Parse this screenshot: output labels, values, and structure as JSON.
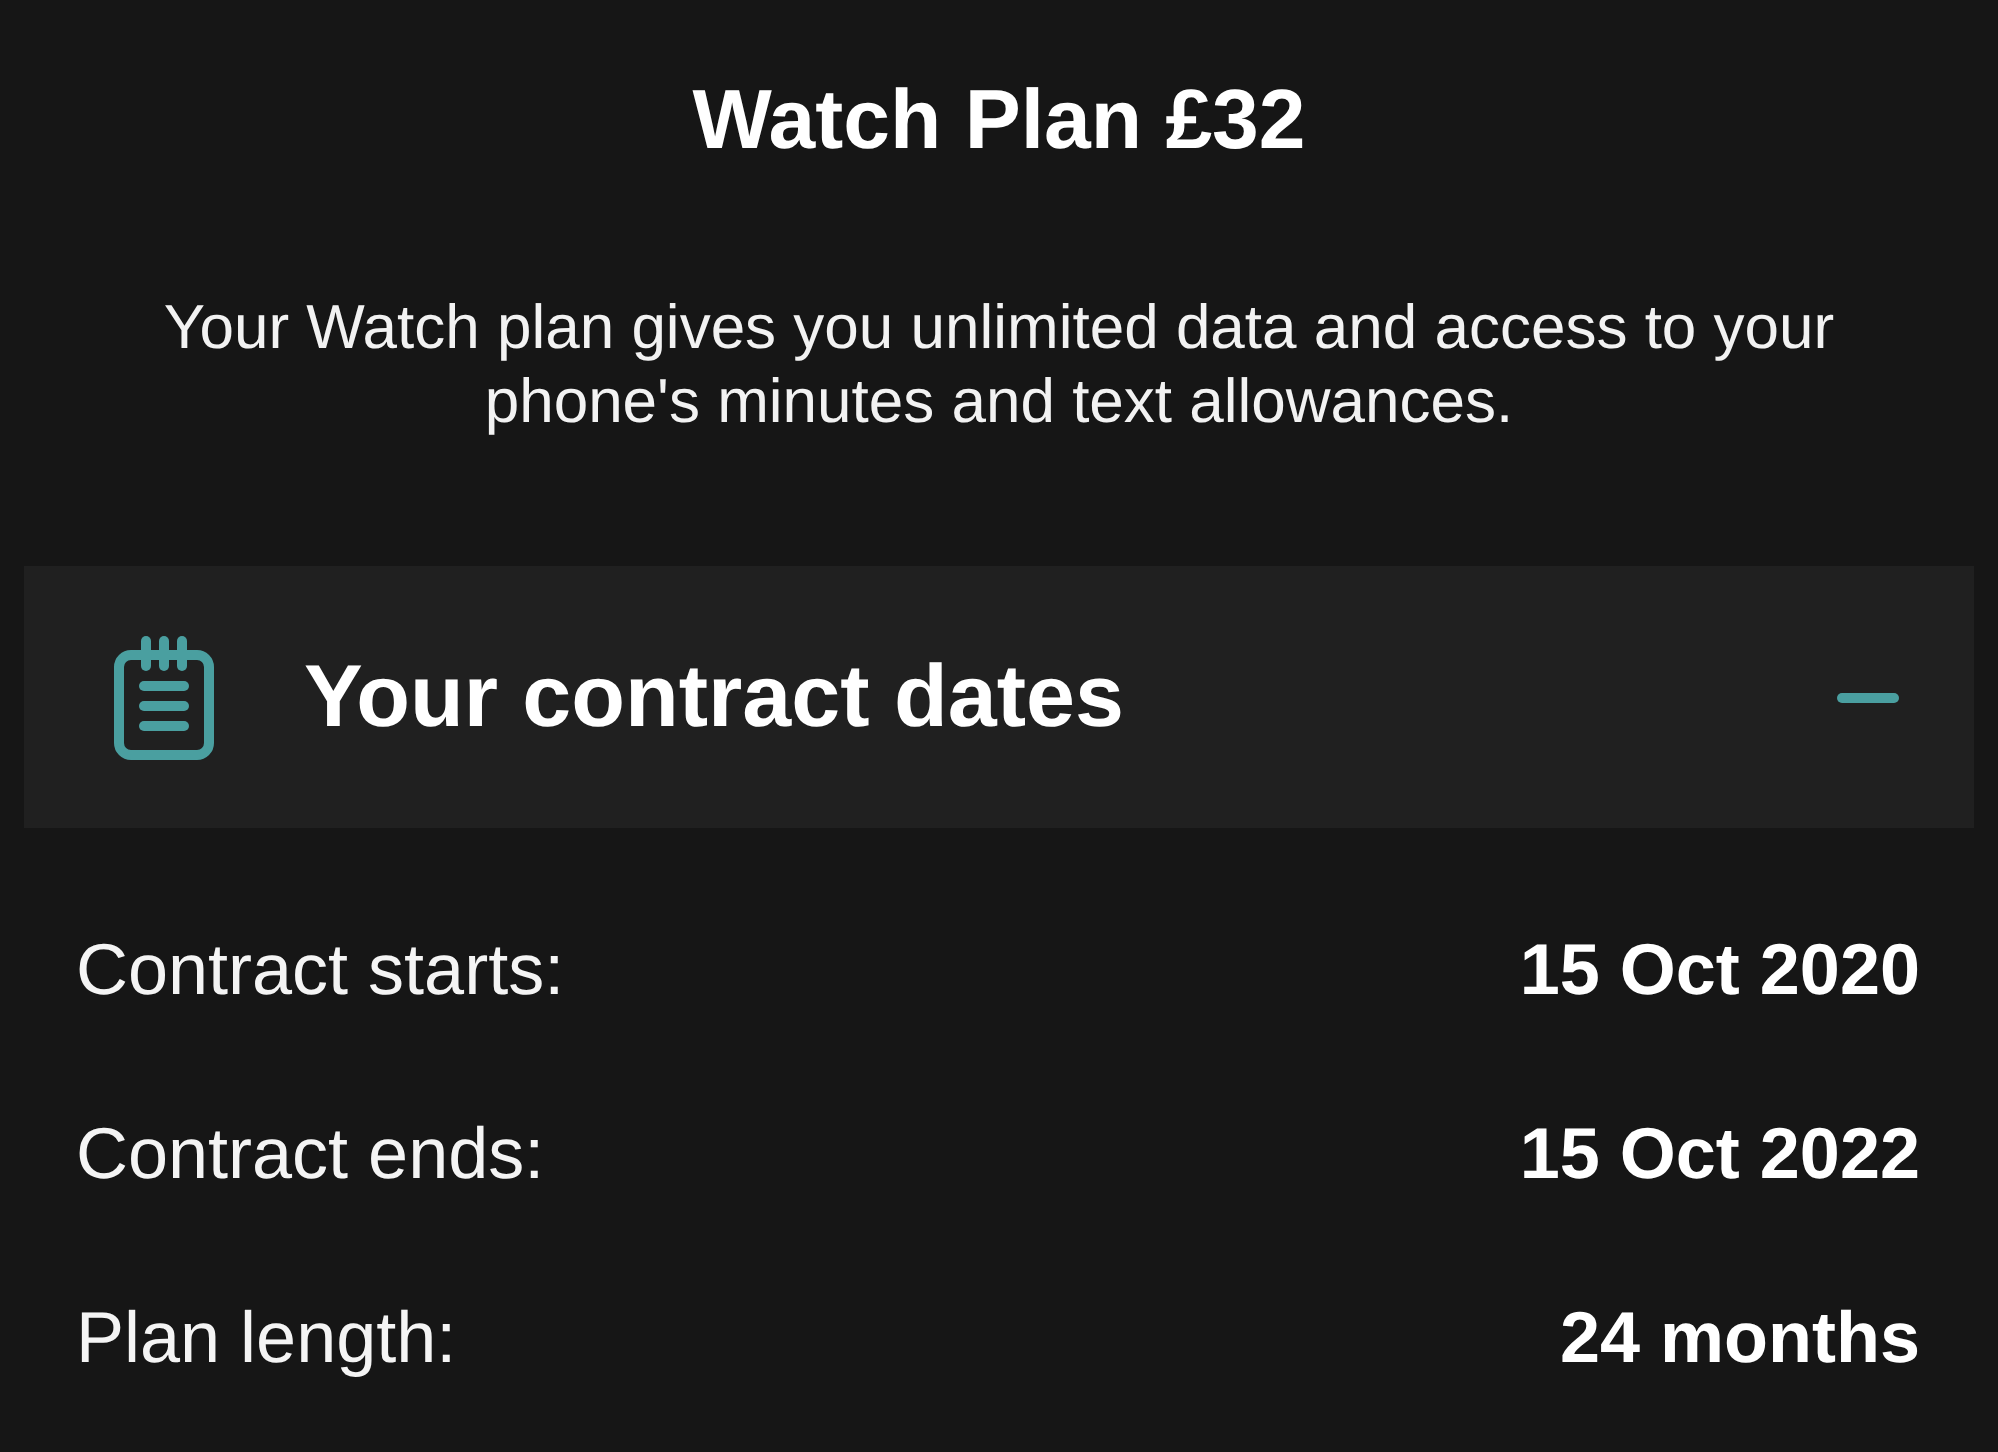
{
  "title": "Watch Plan £32",
  "description": "Your Watch plan gives you unlimited data and access to your phone's minutes and text allowances.",
  "section": {
    "title": "Your contract dates",
    "expanded": true,
    "rows": [
      {
        "label": "Contract starts:",
        "value": "15 Oct 2020"
      },
      {
        "label": "Contract ends:",
        "value": "15 Oct 2022"
      },
      {
        "label": "Plan length:",
        "value": "24 months"
      }
    ]
  }
}
